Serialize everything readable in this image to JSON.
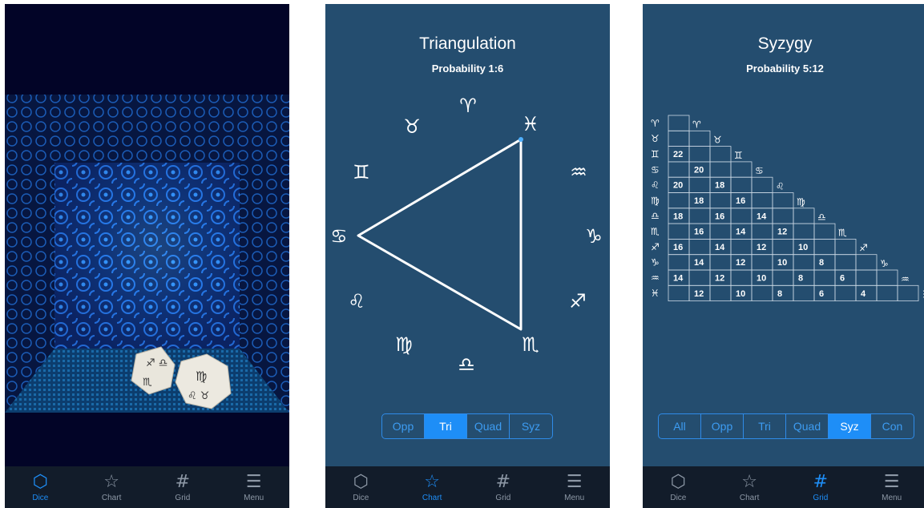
{
  "tabs": [
    {
      "label": "Dice",
      "icon": "dice-icon",
      "glyph": "⬡"
    },
    {
      "label": "Chart",
      "icon": "star-icon",
      "glyph": "☆"
    },
    {
      "label": "Grid",
      "icon": "grid-icon",
      "glyph": "#"
    },
    {
      "label": "Menu",
      "icon": "menu-icon",
      "glyph": "☰"
    }
  ],
  "screen1": {
    "active_tab": 0
  },
  "screen2": {
    "title": "Triangulation",
    "probability": "Probability 1:6",
    "active_tab": 1,
    "segments": [
      "Opp",
      "Tri",
      "Quad",
      "Syz"
    ],
    "selected_segment": "Tri",
    "zodiac": [
      "♈",
      "♉",
      "♊",
      "♋",
      "♌",
      "♍",
      "♎",
      "♏",
      "♐",
      "♑",
      "♒",
      "♓"
    ],
    "triangle_vertices": [
      "♓",
      "♋",
      "♏"
    ]
  },
  "screen3": {
    "title": "Syzygy",
    "probability": "Probability 5:12",
    "active_tab": 2,
    "segments": [
      "All",
      "Opp",
      "Tri",
      "Quad",
      "Syz",
      "Con"
    ],
    "selected_segment": "Syz",
    "signs": [
      "♈",
      "♉",
      "♊",
      "♋",
      "♌",
      "♍",
      "♎",
      "♏",
      "♐",
      "♑",
      "♒",
      "♓"
    ],
    "grid_values": [
      {
        "row": 2,
        "col": 0,
        "value": "22"
      },
      {
        "row": 3,
        "col": 1,
        "value": "20"
      },
      {
        "row": 4,
        "col": 0,
        "value": "20"
      },
      {
        "row": 4,
        "col": 2,
        "value": "18"
      },
      {
        "row": 5,
        "col": 1,
        "value": "18"
      },
      {
        "row": 5,
        "col": 3,
        "value": "16"
      },
      {
        "row": 6,
        "col": 0,
        "value": "18"
      },
      {
        "row": 6,
        "col": 2,
        "value": "16"
      },
      {
        "row": 6,
        "col": 4,
        "value": "14"
      },
      {
        "row": 7,
        "col": 1,
        "value": "16"
      },
      {
        "row": 7,
        "col": 3,
        "value": "14"
      },
      {
        "row": 7,
        "col": 5,
        "value": "12"
      },
      {
        "row": 8,
        "col": 0,
        "value": "16"
      },
      {
        "row": 8,
        "col": 2,
        "value": "14"
      },
      {
        "row": 8,
        "col": 4,
        "value": "12"
      },
      {
        "row": 8,
        "col": 6,
        "value": "10"
      },
      {
        "row": 9,
        "col": 1,
        "value": "14"
      },
      {
        "row": 9,
        "col": 3,
        "value": "12"
      },
      {
        "row": 9,
        "col": 5,
        "value": "10"
      },
      {
        "row": 9,
        "col": 7,
        "value": "8"
      },
      {
        "row": 10,
        "col": 0,
        "value": "14"
      },
      {
        "row": 10,
        "col": 2,
        "value": "12"
      },
      {
        "row": 10,
        "col": 4,
        "value": "10"
      },
      {
        "row": 10,
        "col": 6,
        "value": "8"
      },
      {
        "row": 10,
        "col": 8,
        "value": "6"
      },
      {
        "row": 11,
        "col": 1,
        "value": "12"
      },
      {
        "row": 11,
        "col": 3,
        "value": "10"
      },
      {
        "row": 11,
        "col": 5,
        "value": "8"
      },
      {
        "row": 11,
        "col": 7,
        "value": "6"
      },
      {
        "row": 11,
        "col": 9,
        "value": "4"
      }
    ]
  },
  "colors": {
    "accent": "#1e8ef7",
    "panel": "#244d6f",
    "tabbar": "#121c2a"
  }
}
